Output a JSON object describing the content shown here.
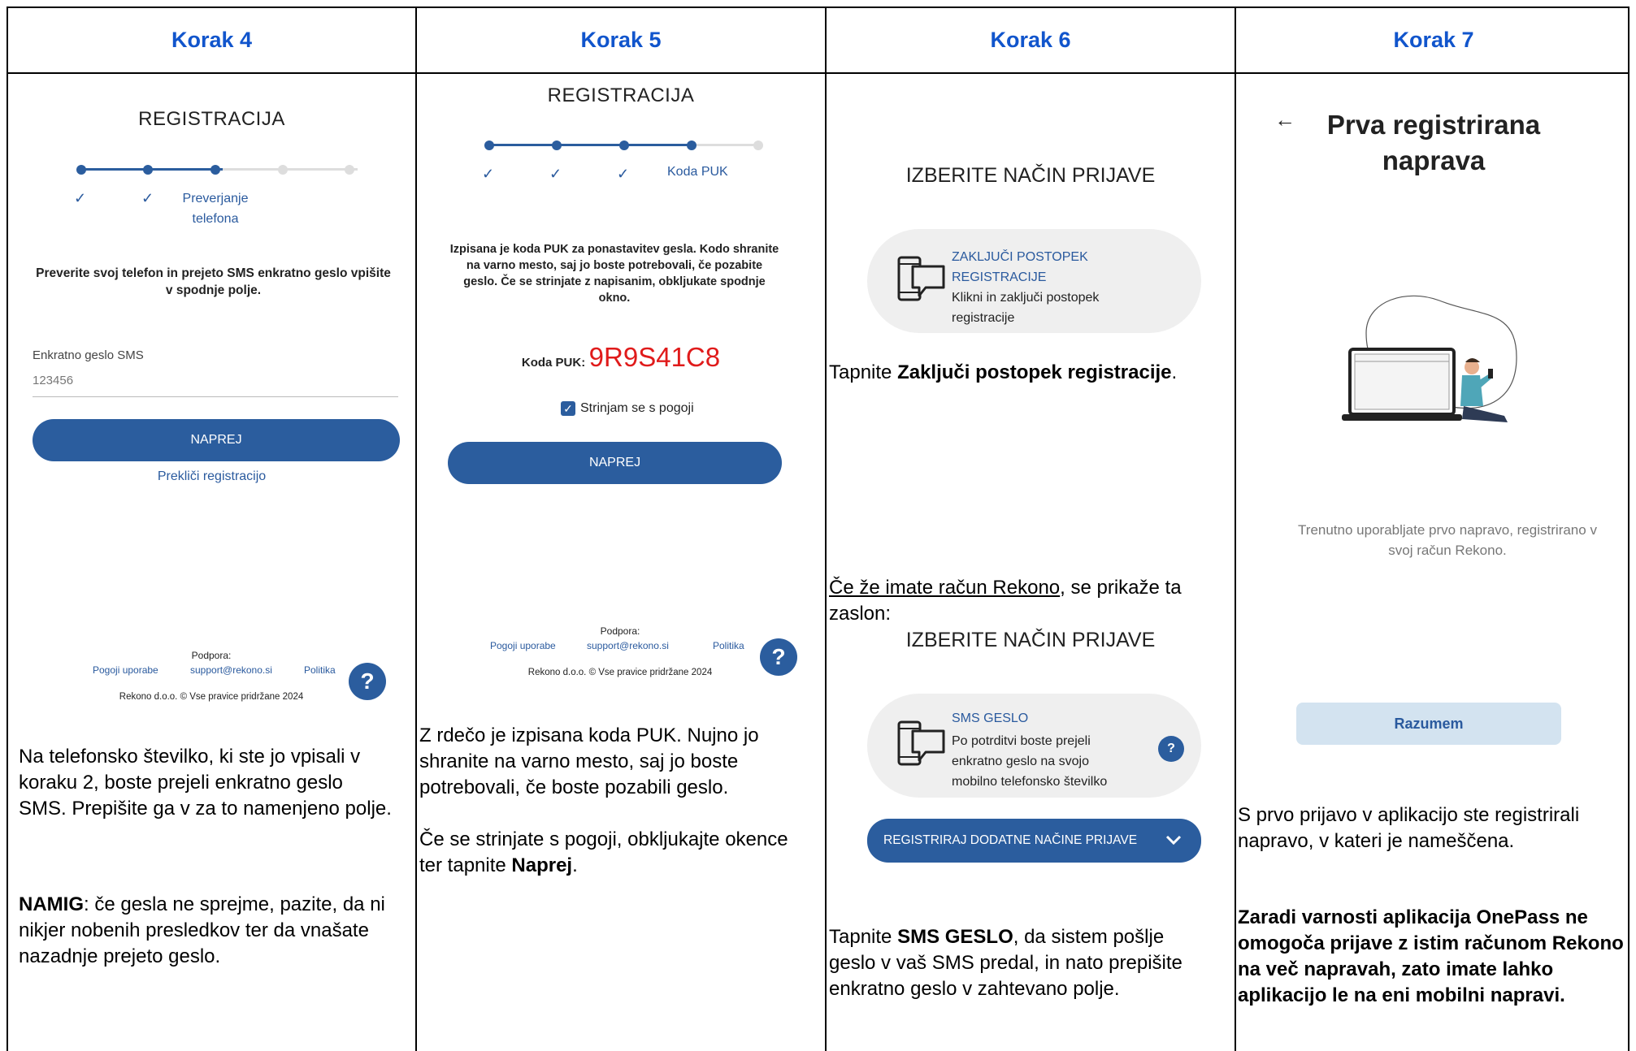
{
  "columns": [
    {
      "header": "Korak 4"
    },
    {
      "header": "Korak 5"
    },
    {
      "header": "Korak 6"
    },
    {
      "header": "Korak 7"
    }
  ],
  "k4": {
    "title": "REGISTRACIJA",
    "step_label": "Preverjanje\ntelefona",
    "instruction": "Preverite svoj telefon in prejeto SMS enkratno geslo vpišite v spodnje polje.",
    "field_label": "Enkratno geslo SMS",
    "field_value": "123456",
    "next_button": "NAPREJ",
    "cancel_link": "Prekliči registracijo",
    "support_label": "Podpora:",
    "terms_link": "Pogoji uporabe",
    "support_email": "support@rekono.si",
    "policy_link": "Politika",
    "copyright": "Rekono d.o.o. © Vse pravice pridržane 2024",
    "help": "?",
    "desc": "Na telefonsko številko, ki ste jo vpisali v koraku 2, boste prejeli enkratno geslo SMS. Prepišite ga v za to namenjeno polje.",
    "tip_bold": "NAMIG",
    "tip_rest": ": če gesla ne sprejme, pazite, da ni nikjer nobenih presledkov ter da vnašate nazadnje prejeto geslo."
  },
  "k5": {
    "title": "REGISTRACIJA",
    "step_label": "Koda PUK",
    "instruction": "Izpisana je koda PUK za ponastavitev gesla. Kodo shranite na varno mesto, saj jo boste potrebovali, če pozabite geslo. Če se strinjate z napisanim, obkljukate spodnje okno.",
    "puk_label": "Koda PUK:",
    "puk_value": "9R9S41C8",
    "agree_label": "Strinjam se s pogoji",
    "next_button": "NAPREJ",
    "support_label": "Podpora:",
    "terms_link": "Pogoji uporabe",
    "support_email": "support@rekono.si",
    "policy_link": "Politika",
    "copyright": "Rekono d.o.o. © Vse pravice pridržane 2024",
    "help": "?",
    "desc1": "Z rdečo je izpisana koda PUK. Nujno jo shranite na varno mesto, saj jo boste potrebovali, če boste pozabili geslo.",
    "desc2_pre": "Če se strinjate s pogoji, obkljukajte okence ter tapnite ",
    "desc2_bold": "Naprej",
    "desc2_post": "."
  },
  "k6": {
    "title1": "IZBERITE NAČIN PRIJAVE",
    "opt1_title": "ZAKLJUČI POSTOPEK REGISTRACIJE",
    "opt1_desc": "Klikni in zaključi postopek registracije",
    "text1_pre": "Tapnite ",
    "text1_bold": "Zaključi postopek registracije",
    "text1_post": ".",
    "text2_link": "Če že imate račun Rekono",
    "text2_rest": ", se prikaže ta zaslon:",
    "title2": "IZBERITE NAČIN PRIJAVE",
    "opt2_title": "SMS GESLO",
    "opt2_desc": "Po potrditvi boste prejeli enkratno geslo na svojo mobilno telefonsko številko",
    "help": "?",
    "more_button": "REGISTRIRAJ DODATNE NAČINE PRIJAVE",
    "text3_pre": "Tapnite ",
    "text3_bold": "SMS GESLO",
    "text3_post": ", da sistem pošlje geslo v vaš SMS predal, in nato prepišite enkratno geslo v zahtevano polje."
  },
  "k7": {
    "back": "←",
    "title": "Prva registrirana naprava",
    "info": "Trenutno uporabljate prvo napravo, registrirano v svoj račun Rekono.",
    "ok_button": "Razumem",
    "desc1": "S prvo prijavo v aplikacijo ste registrirali napravo, v kateri je nameščena.",
    "desc2": "Zaradi varnosti aplikacija OnePass ne omogoča prijave z istim računom Rekono na več napravah, zato imate lahko aplikacijo le na eni mobilni napravi."
  },
  "colors": {
    "header_blue": "#1155cc",
    "button_blue": "#2b5d9e",
    "puk_red": "#e01b1b",
    "ok_button_bg": "#d3e3f0"
  }
}
